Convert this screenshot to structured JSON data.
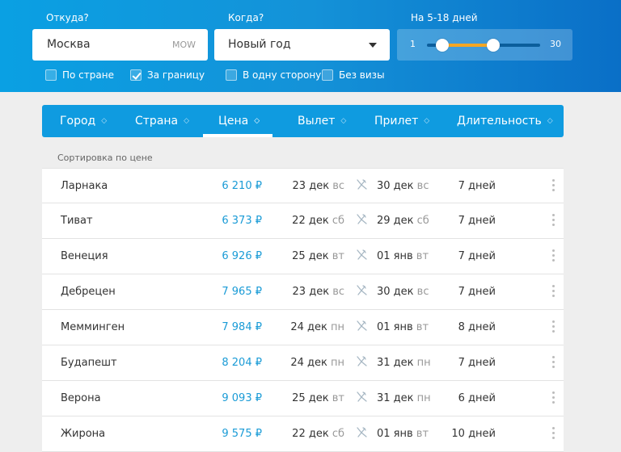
{
  "search": {
    "from_label": "Откуда?",
    "from_value": "Москва",
    "from_code": "MOW",
    "when_label": "Когда?",
    "when_value": "Новый год",
    "days_label": "На 5-18 дней",
    "days_min": "1",
    "days_max": "30",
    "range_low": 5,
    "range_high": 18,
    "range_total_min": 1,
    "range_total_max": 30
  },
  "filters": [
    {
      "label": "По стране",
      "checked": false
    },
    {
      "label": "За границу",
      "checked": true
    },
    {
      "label": "В одну сторону",
      "checked": false
    },
    {
      "label": "Без визы",
      "checked": false
    }
  ],
  "tabs": [
    {
      "label": "Город",
      "active": false
    },
    {
      "label": "Страна",
      "active": false
    },
    {
      "label": "Цена",
      "active": true
    },
    {
      "label": "Вылет",
      "active": false
    },
    {
      "label": "Прилет",
      "active": false
    },
    {
      "label": "Длительность",
      "active": false
    }
  ],
  "sort_caption": "Сортировка по цене",
  "rows": [
    {
      "city": "Ларнака",
      "price": "6 210 ₽",
      "dep_date": "23 дек",
      "dep_dow": "вс",
      "arr_date": "30 дек",
      "arr_dow": "вс",
      "duration": "7 дней"
    },
    {
      "city": "Тиват",
      "price": "6 373 ₽",
      "dep_date": "22 дек",
      "dep_dow": "сб",
      "arr_date": "29 дек",
      "arr_dow": "сб",
      "duration": "7 дней"
    },
    {
      "city": "Венеция",
      "price": "6 926 ₽",
      "dep_date": "25 дек",
      "dep_dow": "вт",
      "arr_date": "01 янв",
      "arr_dow": "вт",
      "duration": "7 дней"
    },
    {
      "city": "Дебрецен",
      "price": "7 965 ₽",
      "dep_date": "23 дек",
      "dep_dow": "вс",
      "arr_date": "30 дек",
      "arr_dow": "вс",
      "duration": "7 дней"
    },
    {
      "city": "Мемминген",
      "price": "7 984 ₽",
      "dep_date": "24 дек",
      "dep_dow": "пн",
      "arr_date": "01 янв",
      "arr_dow": "вт",
      "duration": "8 дней"
    },
    {
      "city": "Будапешт",
      "price": "8 204 ₽",
      "dep_date": "24 дек",
      "dep_dow": "пн",
      "arr_date": "31 дек",
      "arr_dow": "пн",
      "duration": "7 дней"
    },
    {
      "city": "Верона",
      "price": "9 093 ₽",
      "dep_date": "25 дек",
      "dep_dow": "вт",
      "arr_date": "31 дек",
      "arr_dow": "пн",
      "duration": "6 дней"
    },
    {
      "city": "Жирона",
      "price": "9 575 ₽",
      "dep_date": "22 дек",
      "dep_dow": "сб",
      "arr_date": "01 янв",
      "arr_dow": "вт",
      "duration": "10 дней"
    }
  ],
  "icons": {
    "sort": "sort-arrows-icon",
    "plane": "plane-icon",
    "more": "more-vertical-icon",
    "dropdown": "chevron-down-icon"
  },
  "colors": {
    "header_start": "#0aa0e3",
    "header_end": "#0a6fc7",
    "tabs_bg": "#0f9be0",
    "price": "#1a9bd6",
    "range_fill": "#f5a623"
  }
}
